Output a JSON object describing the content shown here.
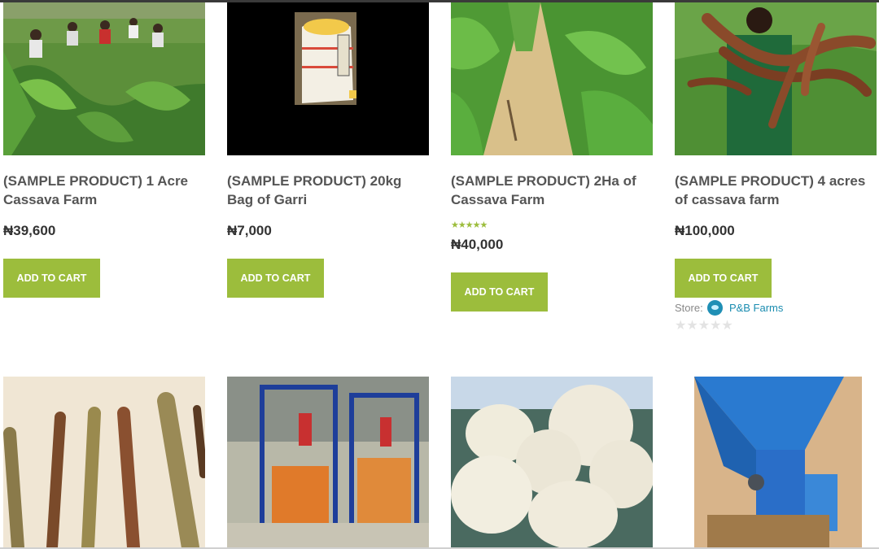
{
  "products_row1": [
    {
      "title": "(SAMPLE PRODUCT) 1 Acre Cassava Farm",
      "price": "₦39,600",
      "button": "ADD TO CART",
      "image": "cassava-field-workers-photo"
    },
    {
      "title": "(SAMPLE PRODUCT) 20kg Bag of Garri",
      "price": "₦7,000",
      "button": "ADD TO CART",
      "image": "garri-bag-photo"
    },
    {
      "title": "(SAMPLE PRODUCT) 2Ha of Cassava Farm",
      "price": "₦40,000",
      "button": "ADD TO CART",
      "rating": "★★★★★",
      "image": "cassava-rows-photo"
    },
    {
      "title": "(SAMPLE PRODUCT) 4 acres of cassava farm",
      "price": "₦100,000",
      "button": "ADD TO CART",
      "store_label": "Store:",
      "store_name": "P&B Farms",
      "rating_empty": "★★★★★",
      "image": "cassava-tubers-photo"
    }
  ],
  "products_row2_images": [
    "cassava-stems-photo",
    "hydraulic-press-photo",
    "fufu-balls-photo",
    "grater-machine-photo"
  ],
  "colors": {
    "accent": "#9cbd3c",
    "link": "#1a8cb0"
  }
}
